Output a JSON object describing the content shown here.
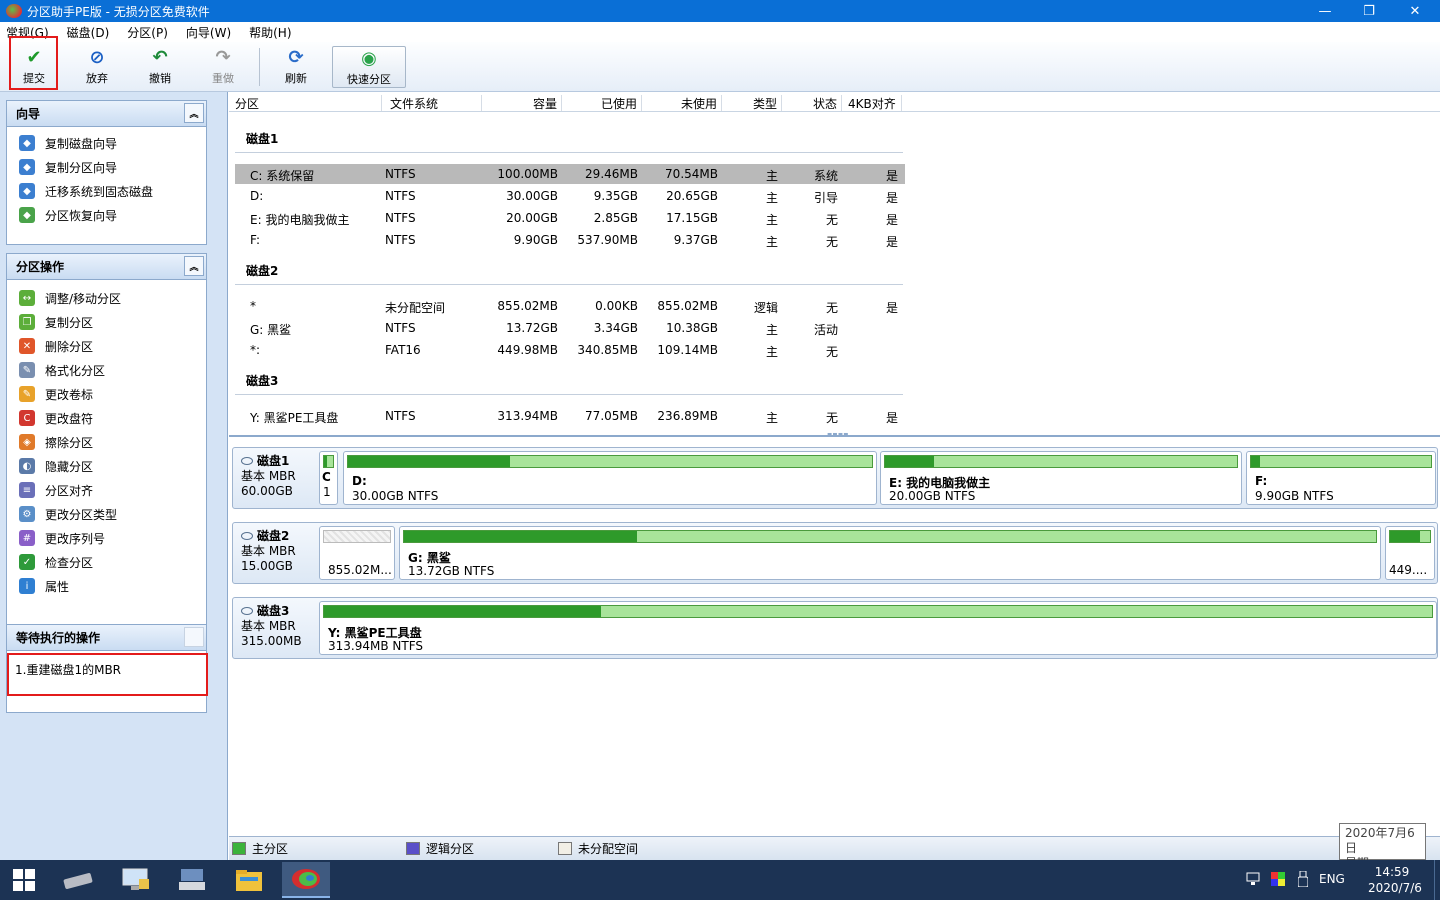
{
  "window": {
    "title": "分区助手PE版 - 无损分区免费软件",
    "minimize": "—",
    "maximize": "❐",
    "close": "✕"
  },
  "menu": [
    "常规(G)",
    "磁盘(D)",
    "分区(P)",
    "向导(W)",
    "帮助(H)"
  ],
  "toolbar": {
    "commit": "提交",
    "discard": "放弃",
    "undo": "撤销",
    "redo": "重做",
    "refresh": "刷新",
    "quick_partition": "快速分区"
  },
  "wizard_panel": {
    "title": "向导",
    "items": [
      "复制磁盘向导",
      "复制分区向导",
      "迁移系统到固态磁盘",
      "分区恢复向导"
    ]
  },
  "ops_panel": {
    "title": "分区操作",
    "items": [
      "调整/移动分区",
      "复制分区",
      "删除分区",
      "格式化分区",
      "更改卷标",
      "更改盘符",
      "擦除分区",
      "隐藏分区",
      "分区对齐",
      "更改分区类型",
      "更改序列号",
      "检查分区",
      "属性"
    ]
  },
  "pending_panel": {
    "title": "等待执行的操作",
    "items": [
      "1.重建磁盘1的MBR"
    ]
  },
  "table": {
    "headers": [
      "分区",
      "文件系统",
      "容量",
      "已使用",
      "未使用",
      "类型",
      "状态",
      "4KB对齐"
    ],
    "disks": [
      {
        "name": "磁盘1",
        "rows": [
          [
            "C: 系统保留",
            "NTFS",
            "100.00MB",
            "29.46MB",
            "70.54MB",
            "主",
            "系统",
            "是"
          ],
          [
            "D:",
            "NTFS",
            "30.00GB",
            "9.35GB",
            "20.65GB",
            "主",
            "引导",
            "是"
          ],
          [
            "E: 我的电脑我做主",
            "NTFS",
            "20.00GB",
            "2.85GB",
            "17.15GB",
            "主",
            "无",
            "是"
          ],
          [
            "F:",
            "NTFS",
            "9.90GB",
            "537.90MB",
            "9.37GB",
            "主",
            "无",
            "是"
          ]
        ]
      },
      {
        "name": "磁盘2",
        "rows": [
          [
            "*",
            "未分配空间",
            "855.02MB",
            "0.00KB",
            "855.02MB",
            "逻辑",
            "无",
            "是"
          ],
          [
            "G: 黑鲨",
            "NTFS",
            "13.72GB",
            "3.34GB",
            "10.38GB",
            "主",
            "活动",
            ""
          ],
          [
            "*:",
            "FAT16",
            "449.98MB",
            "340.85MB",
            "109.14MB",
            "主",
            "无",
            ""
          ]
        ]
      },
      {
        "name": "磁盘3",
        "rows": [
          [
            "Y: 黑鲨PE工具盘",
            "NTFS",
            "313.94MB",
            "77.05MB",
            "236.89MB",
            "主",
            "无",
            "是"
          ]
        ]
      }
    ]
  },
  "diskmap": [
    {
      "name": "磁盘1",
      "type": "基本 MBR",
      "size": "60.00GB",
      "parts": [
        {
          "label": "C",
          "size": "1",
          "used": 0.29
        },
        {
          "label": "D:",
          "size": "30.00GB NTFS",
          "used": 0.31
        },
        {
          "label": "E: 我的电脑我做主",
          "size": "20.00GB NTFS",
          "used": 0.14
        },
        {
          "label": "F:",
          "size": "9.90GB NTFS",
          "used": 0.05
        }
      ]
    },
    {
      "name": "磁盘2",
      "type": "基本 MBR",
      "size": "15.00GB",
      "parts": [
        {
          "label": "",
          "size": "855.02M...",
          "used": 0
        },
        {
          "label": "G: 黑鲨",
          "size": "13.72GB NTFS",
          "used": 0.24
        },
        {
          "label": "",
          "size": "449....",
          "used": 0.76
        }
      ]
    },
    {
      "name": "磁盘3",
      "type": "基本 MBR",
      "size": "315.00MB",
      "parts": [
        {
          "label": "Y: 黑鲨PE工具盘",
          "size": "313.94MB NTFS",
          "used": 0.25
        }
      ]
    }
  ],
  "legend": {
    "primary": "主分区",
    "logical": "逻辑分区",
    "unallocated": "未分配空间",
    "colors": {
      "primary": "#3bb33b",
      "logical": "#5a4fc8",
      "unallocated": "#f2efe6"
    }
  },
  "taskbar": {
    "ime": "ENG",
    "time": "14:59",
    "date": "2020/7/6"
  },
  "date_tooltip": {
    "line1": "2020年7月6日",
    "line2": "星期一"
  }
}
